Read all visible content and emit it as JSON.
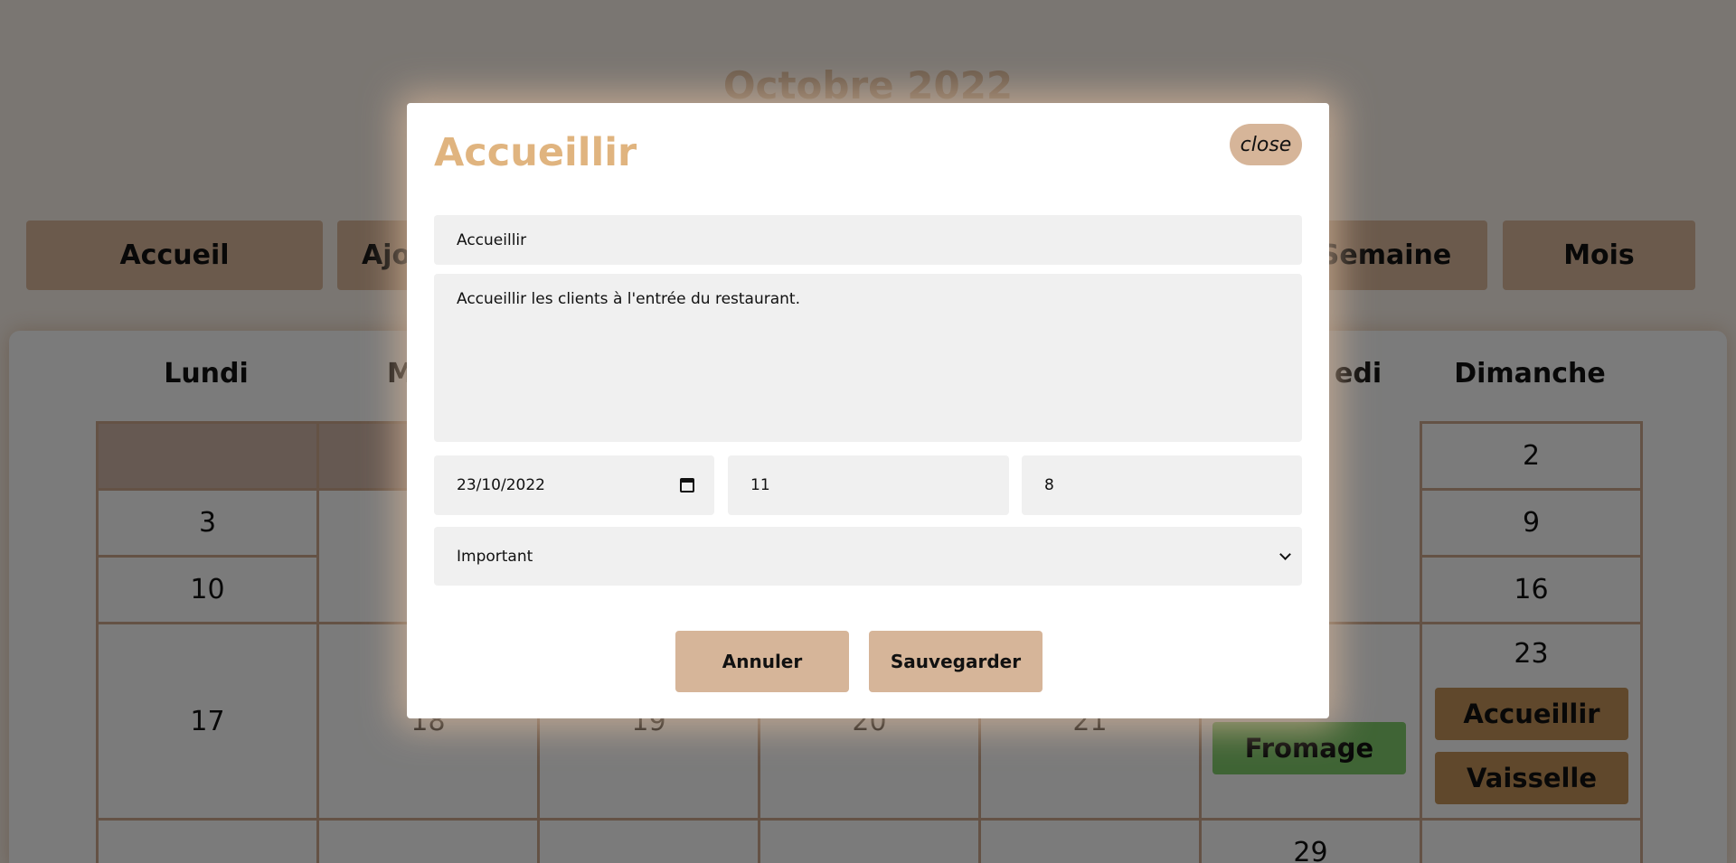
{
  "page": {
    "month_title": "Octobre 2022",
    "nav": [
      {
        "label": "Accueil"
      },
      {
        "label": "Ajo"
      },
      {
        "label": "Semaine"
      },
      {
        "label": "Mois"
      }
    ],
    "weekdays": [
      "Lundi",
      "M",
      "",
      "",
      "",
      "edi",
      "Dimanche"
    ],
    "days": {
      "mon_w2": "3",
      "mon_w3": "10",
      "mon_w4": "17",
      "tue_w4": "18",
      "wed_w4": "19",
      "thu_w4": "20",
      "fri_w4": "21",
      "sat_w5": "29",
      "sun_w1": "2",
      "sun_w2": "9",
      "sun_w3": "16",
      "sun_w4": "23"
    },
    "events": {
      "sun_23_1": "Accueillir",
      "sun_23_2": "Vaisselle",
      "sat_22_1": "Fromage"
    },
    "colors": {
      "accent": "#d6b599",
      "title": "#e0b47f",
      "event_brown": "#c19058",
      "event_green": "#7fc86a"
    }
  },
  "modal": {
    "title": "Accueillir",
    "close_label": "close",
    "fields": {
      "title_value": "Accueillir",
      "description_value": "Accueillir les clients à l'entrée du restaurant.",
      "date_value": "23/10/2022",
      "start_value": "11",
      "end_value": "8",
      "priority_value": "Important"
    },
    "icons": {
      "date": "calendar-icon",
      "select": "chevron-down-icon"
    },
    "buttons": {
      "cancel": "Annuler",
      "save": "Sauvegarder"
    }
  }
}
